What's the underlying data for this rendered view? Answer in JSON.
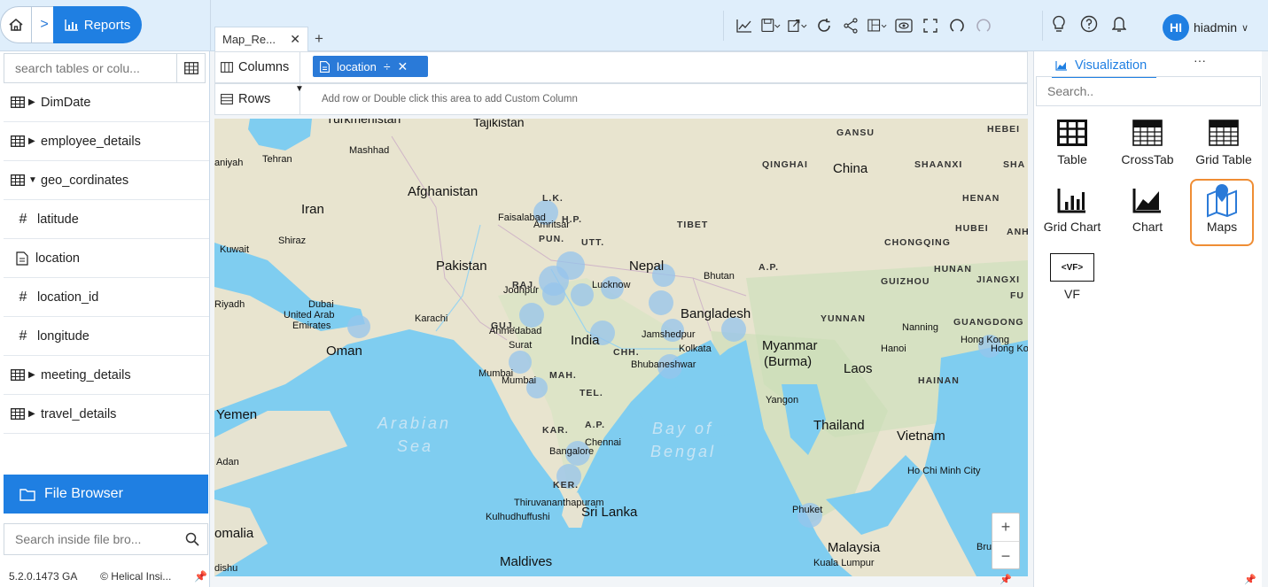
{
  "header": {
    "breadcrumb_label": "Reports",
    "tab_label": "Map_Re...",
    "tab_add": "+",
    "tab_close": "✕",
    "user_initials": "HI",
    "user_name": "hiadmin"
  },
  "toolbar_icons": [
    "chart-icon",
    "save-icon",
    "export-icon",
    "refresh-icon",
    "share-icon",
    "layout-icon",
    "preview-icon",
    "fullscreen-icon",
    "undo-icon",
    "redo-icon",
    "bulb-icon",
    "help-icon",
    "bell-icon"
  ],
  "sidebar": {
    "search_placeholder": "search tables or colu...",
    "items": [
      {
        "label": "DimDate",
        "type": "table",
        "state": "collapsed"
      },
      {
        "label": "employee_details",
        "type": "table",
        "state": "collapsed"
      },
      {
        "label": "geo_cordinates",
        "type": "table",
        "state": "expanded"
      },
      {
        "label": "latitude",
        "type": "number"
      },
      {
        "label": "location",
        "type": "text"
      },
      {
        "label": "location_id",
        "type": "number"
      },
      {
        "label": "longitude",
        "type": "number"
      },
      {
        "label": "meeting_details",
        "type": "table",
        "state": "collapsed"
      },
      {
        "label": "travel_details",
        "type": "table",
        "state": "collapsed"
      }
    ],
    "file_browser_label": "File Browser",
    "file_search_placeholder": "Search inside file bro...",
    "version": "5.2.0.1473 GA",
    "copyright": "© Helical Insi..."
  },
  "shelves": {
    "columns_label": "Columns",
    "rows_label": "Rows",
    "column_pill": "location",
    "rows_hint": "Add row or Double click this area to add Custom Column"
  },
  "map": {
    "labels": {
      "tajikistan": "Tajikistan",
      "turkmenistan": "Turkmenistan",
      "gansu": "GANSU",
      "hebei": "HEBEI",
      "mashhad": "Mashhad",
      "tehran": "Tehran",
      "niyah": "aniyah",
      "qinghai": "QINGHAI",
      "china": "China",
      "shaanxi": "SHAANXI",
      "sha": "SHA",
      "afghanistan": "Afghanistan",
      "henan": "HENAN",
      "iran": "Iran",
      "lk": "L.K.",
      "faisalabad": "Faisalabad",
      "hp": "H.P.",
      "amritsar": "Amritsar",
      "tibet": "TIBET",
      "hubei": "HUBEI",
      "anh": "ANH",
      "shiraz": "Shiraz",
      "pun": "PUN.",
      "utt": "UTT.",
      "chongqing": "CHONGQING",
      "kuwait": "Kuwait",
      "pakistan": "Pakistan",
      "nepal": "Nepal",
      "hunan": "HUNAN",
      "ap_ne": "A.P.",
      "bhutan": "Bhutan",
      "guizhou": "GUIZHOU",
      "jiangxi": "JIANGXI",
      "raj": "RAJ.",
      "lucknow": "Lucknow",
      "jodhpur": "Jodhpur",
      "fu": "FU",
      "riyadh": "Riyadh",
      "dubai": "Dubai",
      "uae1": "United Arab",
      "uae2": "Emirates",
      "karachi": "Karachi",
      "bangladesh": "Bangladesh",
      "yunnan": "YUNNAN",
      "guangdong": "GUANGDONG",
      "guj": "GUJ.",
      "ahmedabad": "Ahmedabad",
      "india": "India",
      "jamshedpur": "Jamshedpur",
      "nanning": "Nanning",
      "hongkong": "Hong Kong",
      "hk2": "Hong Ko",
      "oman": "Oman",
      "surat": "Surat",
      "chh": "CHH.",
      "kolkata": "Kolkata",
      "myanmar": "Myanmar",
      "burma": "(Burma)",
      "hanoi": "Hanoi",
      "bhubaneshwar": "Bhubaneshwar",
      "mumbai1": "Mumbai",
      "mumbai2": "Mumbai",
      "mah": "MAH.",
      "laos": "Laos",
      "hainan": "HAINAN",
      "tel": "TEL.",
      "yangon": "Yangon",
      "yemen": "Yemen",
      "arabian1": "Arabian",
      "arabian2": "Sea",
      "thailand": "Thailand",
      "kar": "KAR.",
      "ap_s": "A.P.",
      "bayof": "Bay of",
      "bengal": "Bengal",
      "vietnam": "Vietnam",
      "chennai": "Chennai",
      "bangalore": "Bangalore",
      "adan": "Adan",
      "hochiminh": "Ho Chi Minh City",
      "ker": "KER.",
      "thiruvananthapuram": "Thiruvananthapuram",
      "kulhudhuffushi": "Kulhudhuffushi",
      "srilanka": "Sri Lanka",
      "phuket": "Phuket",
      "somalia": "omalia",
      "malaysia": "Malaysia",
      "bru": "Bru",
      "maldives": "Maldives",
      "kualalumpur": "Kuala Lumpur",
      "dishu": "dishu"
    },
    "zoom_in": "+",
    "zoom_out": "−"
  },
  "visualization": {
    "tab_label": "Visualization",
    "more": "···",
    "search_placeholder": "Search..",
    "types": [
      {
        "label": "Table",
        "icon": "table-icon"
      },
      {
        "label": "CrossTab",
        "icon": "crosstab-icon"
      },
      {
        "label": "Grid Table",
        "icon": "grid-table-icon"
      },
      {
        "label": "Grid Chart",
        "icon": "grid-chart-icon"
      },
      {
        "label": "Chart",
        "icon": "area-chart-icon"
      },
      {
        "label": "Maps",
        "icon": "map-icon",
        "selected": true
      },
      {
        "label": "VF",
        "icon": "vf-icon",
        "glyph": "<VF>"
      }
    ]
  },
  "colors": {
    "accent": "#1f7fe2",
    "selected_border": "#ef8d34",
    "bubble": "#96c4ec",
    "water": "#7fcdf0",
    "land": "#e6e3d1"
  }
}
